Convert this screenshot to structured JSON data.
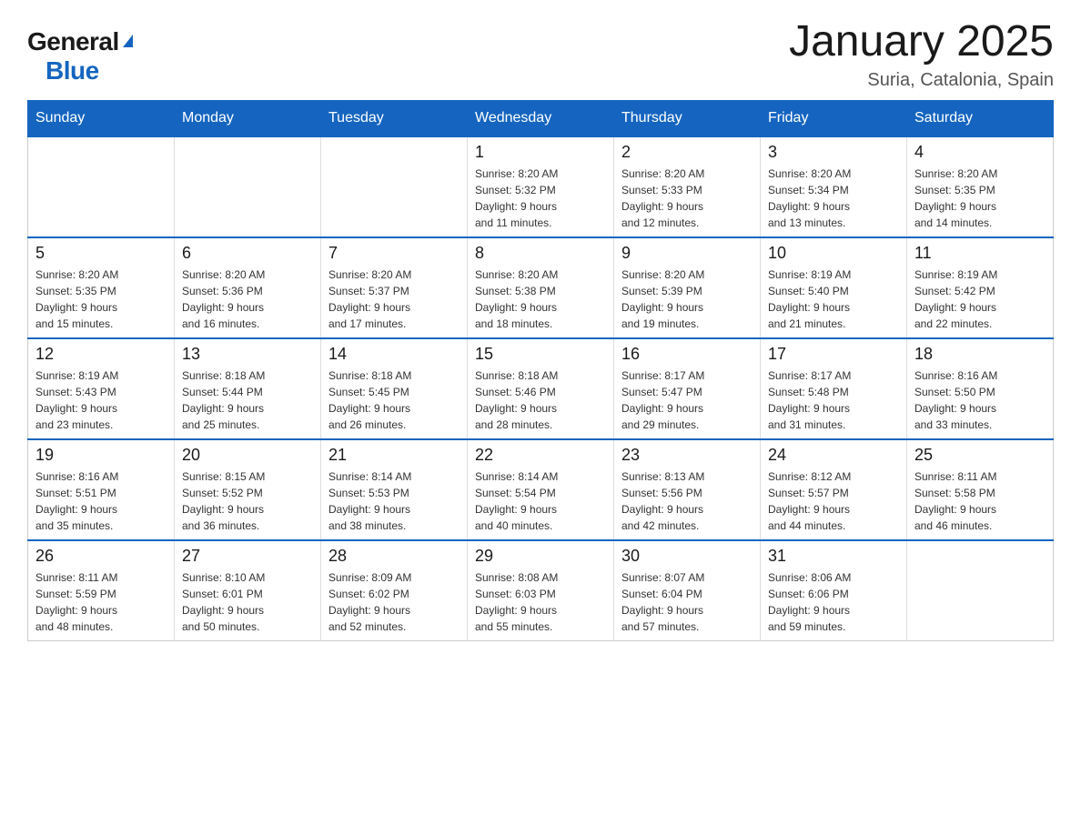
{
  "header": {
    "logo": {
      "general": "General",
      "blue": "Blue",
      "triangle": "▼"
    },
    "title": "January 2025",
    "subtitle": "Suria, Catalonia, Spain"
  },
  "calendar": {
    "headers": [
      "Sunday",
      "Monday",
      "Tuesday",
      "Wednesday",
      "Thursday",
      "Friday",
      "Saturday"
    ],
    "weeks": [
      [
        {
          "day": "",
          "info": ""
        },
        {
          "day": "",
          "info": ""
        },
        {
          "day": "",
          "info": ""
        },
        {
          "day": "1",
          "info": "Sunrise: 8:20 AM\nSunset: 5:32 PM\nDaylight: 9 hours\nand 11 minutes."
        },
        {
          "day": "2",
          "info": "Sunrise: 8:20 AM\nSunset: 5:33 PM\nDaylight: 9 hours\nand 12 minutes."
        },
        {
          "day": "3",
          "info": "Sunrise: 8:20 AM\nSunset: 5:34 PM\nDaylight: 9 hours\nand 13 minutes."
        },
        {
          "day": "4",
          "info": "Sunrise: 8:20 AM\nSunset: 5:35 PM\nDaylight: 9 hours\nand 14 minutes."
        }
      ],
      [
        {
          "day": "5",
          "info": "Sunrise: 8:20 AM\nSunset: 5:35 PM\nDaylight: 9 hours\nand 15 minutes."
        },
        {
          "day": "6",
          "info": "Sunrise: 8:20 AM\nSunset: 5:36 PM\nDaylight: 9 hours\nand 16 minutes."
        },
        {
          "day": "7",
          "info": "Sunrise: 8:20 AM\nSunset: 5:37 PM\nDaylight: 9 hours\nand 17 minutes."
        },
        {
          "day": "8",
          "info": "Sunrise: 8:20 AM\nSunset: 5:38 PM\nDaylight: 9 hours\nand 18 minutes."
        },
        {
          "day": "9",
          "info": "Sunrise: 8:20 AM\nSunset: 5:39 PM\nDaylight: 9 hours\nand 19 minutes."
        },
        {
          "day": "10",
          "info": "Sunrise: 8:19 AM\nSunset: 5:40 PM\nDaylight: 9 hours\nand 21 minutes."
        },
        {
          "day": "11",
          "info": "Sunrise: 8:19 AM\nSunset: 5:42 PM\nDaylight: 9 hours\nand 22 minutes."
        }
      ],
      [
        {
          "day": "12",
          "info": "Sunrise: 8:19 AM\nSunset: 5:43 PM\nDaylight: 9 hours\nand 23 minutes."
        },
        {
          "day": "13",
          "info": "Sunrise: 8:18 AM\nSunset: 5:44 PM\nDaylight: 9 hours\nand 25 minutes."
        },
        {
          "day": "14",
          "info": "Sunrise: 8:18 AM\nSunset: 5:45 PM\nDaylight: 9 hours\nand 26 minutes."
        },
        {
          "day": "15",
          "info": "Sunrise: 8:18 AM\nSunset: 5:46 PM\nDaylight: 9 hours\nand 28 minutes."
        },
        {
          "day": "16",
          "info": "Sunrise: 8:17 AM\nSunset: 5:47 PM\nDaylight: 9 hours\nand 29 minutes."
        },
        {
          "day": "17",
          "info": "Sunrise: 8:17 AM\nSunset: 5:48 PM\nDaylight: 9 hours\nand 31 minutes."
        },
        {
          "day": "18",
          "info": "Sunrise: 8:16 AM\nSunset: 5:50 PM\nDaylight: 9 hours\nand 33 minutes."
        }
      ],
      [
        {
          "day": "19",
          "info": "Sunrise: 8:16 AM\nSunset: 5:51 PM\nDaylight: 9 hours\nand 35 minutes."
        },
        {
          "day": "20",
          "info": "Sunrise: 8:15 AM\nSunset: 5:52 PM\nDaylight: 9 hours\nand 36 minutes."
        },
        {
          "day": "21",
          "info": "Sunrise: 8:14 AM\nSunset: 5:53 PM\nDaylight: 9 hours\nand 38 minutes."
        },
        {
          "day": "22",
          "info": "Sunrise: 8:14 AM\nSunset: 5:54 PM\nDaylight: 9 hours\nand 40 minutes."
        },
        {
          "day": "23",
          "info": "Sunrise: 8:13 AM\nSunset: 5:56 PM\nDaylight: 9 hours\nand 42 minutes."
        },
        {
          "day": "24",
          "info": "Sunrise: 8:12 AM\nSunset: 5:57 PM\nDaylight: 9 hours\nand 44 minutes."
        },
        {
          "day": "25",
          "info": "Sunrise: 8:11 AM\nSunset: 5:58 PM\nDaylight: 9 hours\nand 46 minutes."
        }
      ],
      [
        {
          "day": "26",
          "info": "Sunrise: 8:11 AM\nSunset: 5:59 PM\nDaylight: 9 hours\nand 48 minutes."
        },
        {
          "day": "27",
          "info": "Sunrise: 8:10 AM\nSunset: 6:01 PM\nDaylight: 9 hours\nand 50 minutes."
        },
        {
          "day": "28",
          "info": "Sunrise: 8:09 AM\nSunset: 6:02 PM\nDaylight: 9 hours\nand 52 minutes."
        },
        {
          "day": "29",
          "info": "Sunrise: 8:08 AM\nSunset: 6:03 PM\nDaylight: 9 hours\nand 55 minutes."
        },
        {
          "day": "30",
          "info": "Sunrise: 8:07 AM\nSunset: 6:04 PM\nDaylight: 9 hours\nand 57 minutes."
        },
        {
          "day": "31",
          "info": "Sunrise: 8:06 AM\nSunset: 6:06 PM\nDaylight: 9 hours\nand 59 minutes."
        },
        {
          "day": "",
          "info": ""
        }
      ]
    ]
  }
}
